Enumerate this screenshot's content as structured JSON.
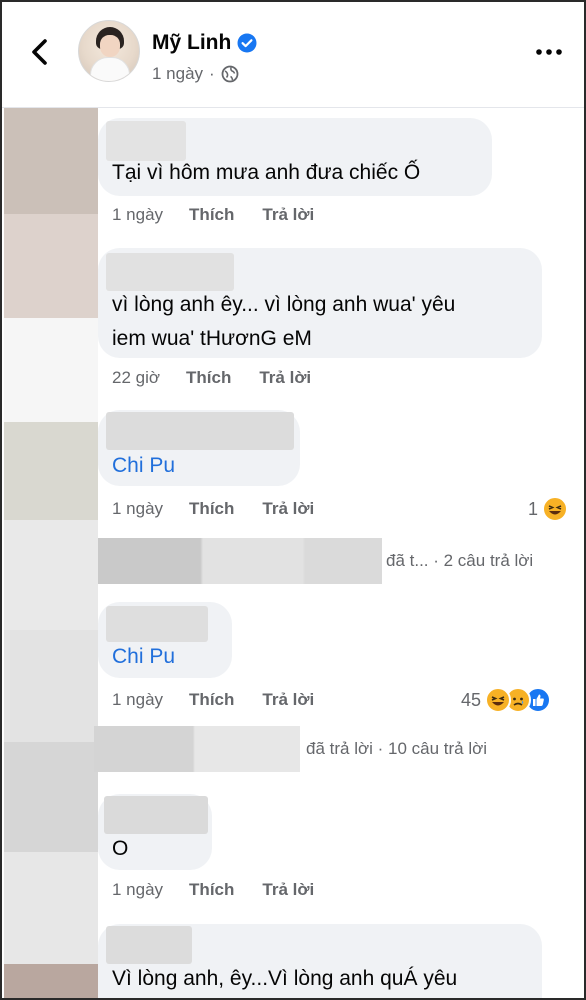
{
  "header": {
    "back_icon": "chevron-left-icon",
    "page_name": "Mỹ Linh",
    "verified_icon": "verified-badge-icon",
    "time": "1 ngày",
    "separator": "·",
    "privacy_icon": "globe-icon",
    "more_icon": "more-horizontal-icon"
  },
  "comments": [
    {
      "text": "Tại vì hôm mưa anh đưa chiếc Ố",
      "time": "1 ngày",
      "like": "Thích",
      "reply": "Trả lời"
    },
    {
      "text_line1": "vì lòng anh êy... vì lòng anh wua' yêu",
      "text_line2": "iem wua' tHươnG eM",
      "time": "22 giờ",
      "like": "Thích",
      "reply": "Trả lời"
    },
    {
      "text": "Chi Pu",
      "time": "1 ngày",
      "like": "Thích",
      "reply": "Trả lời",
      "reaction_count": "1",
      "replies_text": "đã t... · 2 câu trả lời"
    },
    {
      "text": "Chi Pu",
      "time": "1 ngày",
      "like": "Thích",
      "reply": "Trả lời",
      "reaction_count": "45",
      "replies_text": "đã trả lời · 10 câu trả lời"
    },
    {
      "text": "O",
      "time": "1 ngày",
      "like": "Thích",
      "reply": "Trả lời"
    },
    {
      "text": "Vì lòng anh, êy...Vì lòng anh quÁ yêu"
    }
  ],
  "colors": {
    "link": "#216fdb",
    "bubble": "#f0f2f5",
    "secondary_text": "#65676b",
    "verified": "#1877f2"
  }
}
